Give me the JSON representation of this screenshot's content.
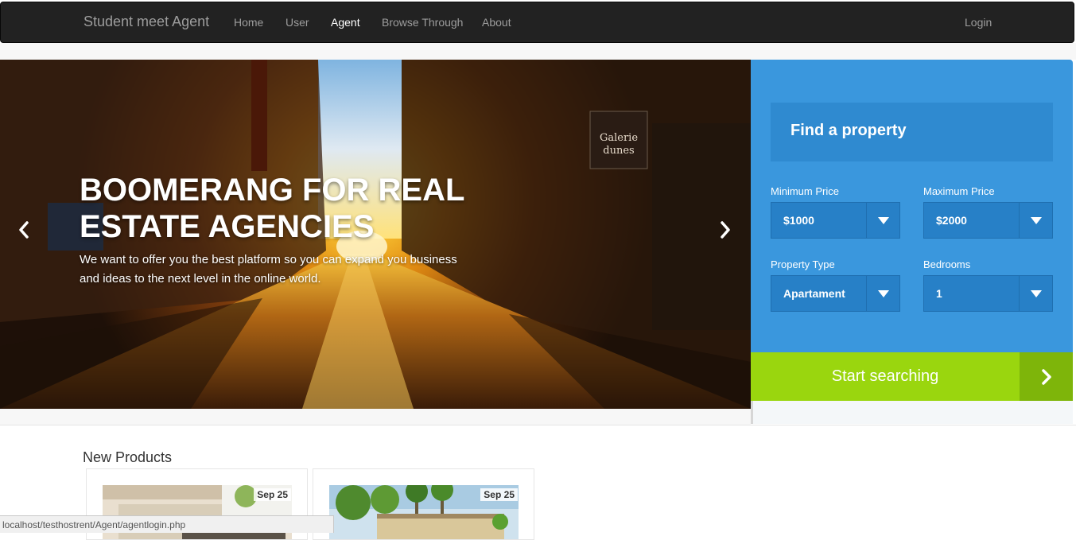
{
  "navbar": {
    "brand": "Student meet Agent",
    "links": [
      {
        "label": "Home",
        "active": false
      },
      {
        "label": "User",
        "active": false
      },
      {
        "label": "Agent",
        "active": true
      },
      {
        "label": "Browse Through",
        "active": false
      },
      {
        "label": "About",
        "active": false
      }
    ],
    "login": "Login"
  },
  "hero": {
    "title": "BOOMERANG FOR REAL ESTATE AGENCIES",
    "subtitle": "We want to offer you the best platform so you can expand you business and ideas to the next level in the online world.",
    "prev_icon": "chevron-left-icon",
    "next_icon": "chevron-right-icon",
    "shop_sign": "Galerie des dunes"
  },
  "search": {
    "title": "Find a property",
    "min_price": {
      "label": "Minimum Price",
      "value": "$1000"
    },
    "max_price": {
      "label": "Maximum Price",
      "value": "$2000"
    },
    "property_type": {
      "label": "Property Type",
      "value": "Apartament"
    },
    "bedrooms": {
      "label": "Bedrooms",
      "value": "1"
    },
    "button": "Start searching",
    "button_icon": "chevron-right-icon"
  },
  "products": {
    "title": "New Products",
    "items": [
      {
        "date": "Sep 25"
      },
      {
        "date": "Sep 25"
      }
    ]
  },
  "status_bar": "localhost/testhostrent/Agent/agentlogin.php",
  "colors": {
    "navbar": "#222222",
    "panel": "#3a97dd",
    "select": "#2780c7",
    "search_button": "#9ad60e"
  }
}
